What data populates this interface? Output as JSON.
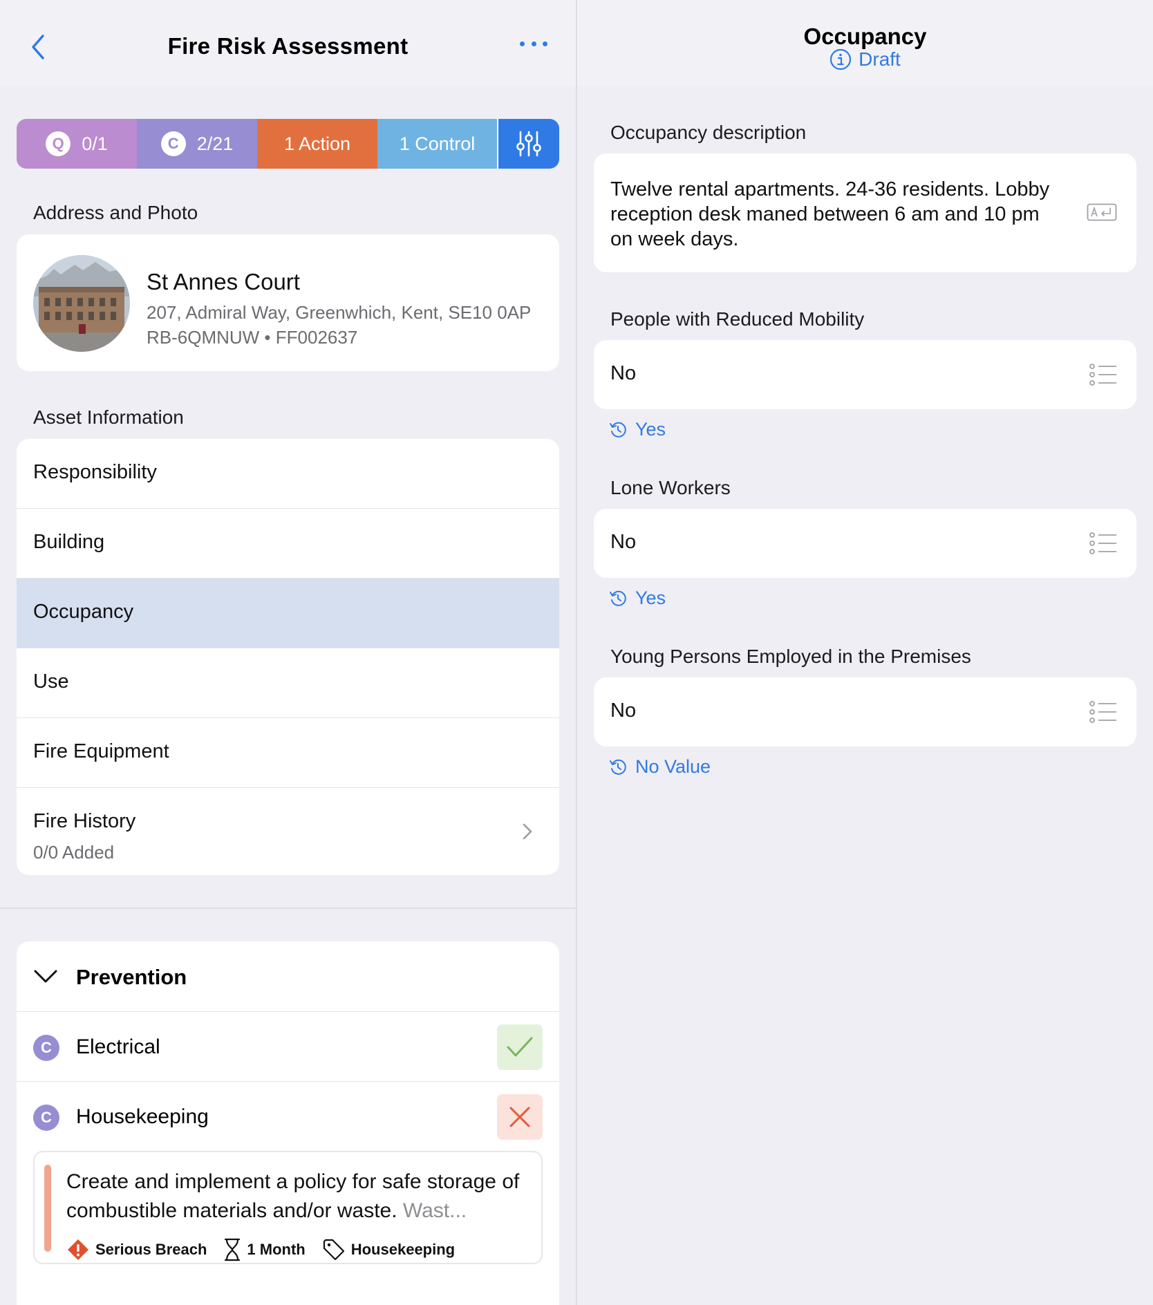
{
  "nav": {
    "title": "Fire Risk Assessment"
  },
  "stats": {
    "questions_badge": "Q",
    "questions": "0/1",
    "controls_badge": "C",
    "controls": "2/21",
    "actions": "1 Action",
    "control_count": "1 Control"
  },
  "address_section": {
    "label": "Address and Photo",
    "name": "St Annes Court",
    "address": "207, Admiral Way, Greenwhich, Kent, SE10 0AP",
    "reference": "RB-6QMNUW • FF002637"
  },
  "asset_section": {
    "label": "Asset Information",
    "items": [
      {
        "label": "Responsibility"
      },
      {
        "label": "Building"
      },
      {
        "label": "Occupancy",
        "selected": true
      },
      {
        "label": "Use"
      },
      {
        "label": "Fire Equipment"
      },
      {
        "label": "Fire History",
        "subtitle": "0/0 Added"
      }
    ]
  },
  "prevention": {
    "title": "Prevention",
    "items": [
      {
        "badge": "C",
        "label": "Electrical",
        "status": "pass"
      },
      {
        "badge": "C",
        "label": "Housekeeping",
        "status": "fail"
      }
    ],
    "action": {
      "text": "Create and implement a policy for safe storage of combustible materials and/or waste.",
      "truncated": "Wast...",
      "severity": "Serious Breach",
      "timeframe": "1 Month",
      "tag": "Housekeeping"
    }
  },
  "detail": {
    "title": "Occupancy",
    "status": "Draft",
    "fields": [
      {
        "label": "Occupancy description",
        "value": "Twelve rental apartments. 24-36 residents. Lobby reception desk maned between 6 am and 10 pm on week days."
      },
      {
        "label": "People with Reduced Mobility",
        "value": "No",
        "previous": "Yes"
      },
      {
        "label": "Lone Workers",
        "value": "No",
        "previous": "Yes"
      },
      {
        "label": "Young Persons Employed in the Premises",
        "value": "No",
        "previous": "No Value"
      }
    ]
  },
  "colors": {
    "accent": "#2f7ae5",
    "questions": "#bb8ccf",
    "controls": "#978dd2",
    "action": "#e2703e",
    "control": "#6fb3e3",
    "selected_row": "#d5dff0"
  }
}
